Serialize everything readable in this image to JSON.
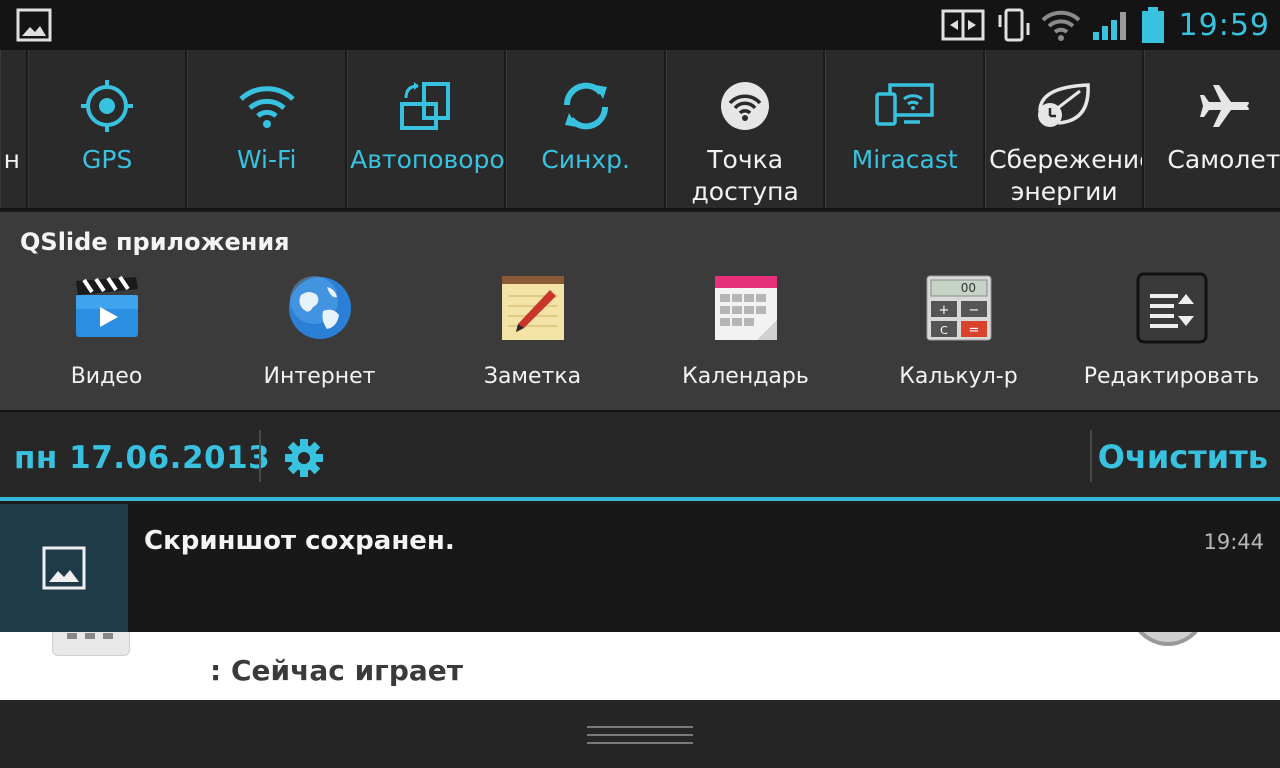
{
  "statusbar": {
    "left_icon": "image-notification-icon",
    "right_icons": [
      "screen-switch-icon",
      "vibrate-icon",
      "wifi-signal-icon",
      "cell-signal-icon",
      "battery-icon"
    ],
    "time": "19:59"
  },
  "quick_settings": {
    "tiles": [
      {
        "label": "н",
        "icon": "partial-icon",
        "state": "off"
      },
      {
        "label": "GPS",
        "icon": "gps-icon",
        "state": "on"
      },
      {
        "label": "Wi-Fi",
        "icon": "wifi-icon",
        "state": "on"
      },
      {
        "label": "Автоповорот",
        "icon": "auto-rotate-icon",
        "state": "on"
      },
      {
        "label": "Синхр.",
        "icon": "sync-icon",
        "state": "on"
      },
      {
        "label": "Точка доступа",
        "icon": "hotspot-icon",
        "state": "off"
      },
      {
        "label": "Miracast",
        "icon": "miracast-icon",
        "state": "on"
      },
      {
        "label": "Сбережение энергии",
        "icon": "power-saver-icon",
        "state": "off"
      },
      {
        "label": "Самолет",
        "icon": "airplane-icon",
        "state": "off"
      }
    ],
    "accent_color": "#39c2e0"
  },
  "qslide": {
    "title": "QSlide приложения",
    "apps": [
      {
        "label": "Видео",
        "icon": "video-icon"
      },
      {
        "label": "Интернет",
        "icon": "globe-icon"
      },
      {
        "label": "Заметка",
        "icon": "memo-icon"
      },
      {
        "label": "Календарь",
        "icon": "calendar-icon"
      },
      {
        "label": "Калькул-р",
        "icon": "calculator-icon"
      },
      {
        "label": "Редактировать",
        "icon": "edit-list-icon"
      }
    ]
  },
  "datebar": {
    "date": "пн 17.06.2013",
    "settings_icon": "gear-icon",
    "clear_label": "Очистить"
  },
  "notification": {
    "title": "Скриншот сохранен.",
    "time": "19:44",
    "icon": "image-icon"
  },
  "peek_card": {
    "text": ": Сейчас играет"
  }
}
